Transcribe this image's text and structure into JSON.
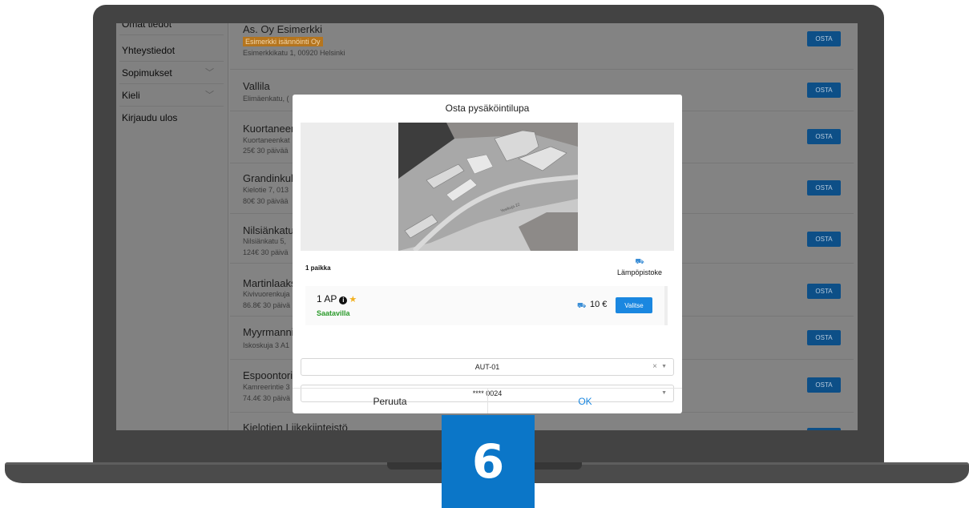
{
  "sidebar": {
    "items": [
      {
        "label": "Omat tiedot",
        "has_chevron": false
      },
      {
        "label": "Yhteystiedot",
        "has_chevron": false
      },
      {
        "label": "Sopimukset",
        "has_chevron": true
      },
      {
        "label": "Kieli",
        "has_chevron": true
      },
      {
        "label": "Kirjaudu ulos",
        "has_chevron": false
      }
    ],
    "chevron_icon": "chevron-down-icon"
  },
  "list": {
    "buy_label": "OSTA",
    "rows": [
      {
        "name": "As. Oy Esimerkki",
        "tag": "Esimerkki isännöinti Oy",
        "address": "Esimerkkikatu 1, 00920 Helsinki",
        "price": ""
      },
      {
        "name": "Vallila",
        "tag": "",
        "address": "Elimäenkatu, (",
        "price": ""
      },
      {
        "name": "Kuortaneen",
        "tag": "",
        "address": "Kuortaneenkat",
        "price": "25€ 30 päivää"
      },
      {
        "name": "Grandinkuln",
        "tag": "",
        "address": "Kielotie 7, 013",
        "price": "80€ 30 päivää"
      },
      {
        "name": "Nilsiänkatu :",
        "tag": "",
        "address": "Nilsiänkatu 5,",
        "price": "124€ 30 päivä"
      },
      {
        "name": "Martinlaaks",
        "tag": "",
        "address": "Kivivuorenkuja",
        "price": "86.8€ 30 päivä"
      },
      {
        "name": "Myyrmanni",
        "tag": "",
        "address": "Iskoskuja 3 A1",
        "price": ""
      },
      {
        "name": "Espoontori",
        "tag": "",
        "address": "Kamreerintie 3",
        "price": "74.4€ 30 päivä"
      },
      {
        "name": "Kielotien Liikekiinteistö",
        "tag": "",
        "address": "",
        "price": ""
      }
    ]
  },
  "modal": {
    "title": "Osta pysäköintilupa",
    "map_street_label": "Yesikuja 22",
    "spot_count": "1 paikka",
    "heater_icon": "car-icon",
    "heater_label": "Lämpöpistoke",
    "spot": {
      "name": "1 AP",
      "info_icon": "i",
      "star_icon": "★",
      "status": "Saatavilla",
      "car_icon": "car-icon",
      "price": "10 €",
      "select_label": "Valitse"
    },
    "vehicle_field": {
      "value": "AUT-01",
      "clear_icon": "×",
      "caret_icon": "▼"
    },
    "card_field": {
      "value": "**** 0024",
      "caret_icon": "▼"
    },
    "cancel_label": "Peruuta",
    "ok_label": "OK"
  },
  "step_badge": "6",
  "colors": {
    "accent": "#1a87e0",
    "success": "#2a9a2a",
    "star": "#f2b01e",
    "badge": "#0b76c8",
    "laptop": "#434343"
  }
}
